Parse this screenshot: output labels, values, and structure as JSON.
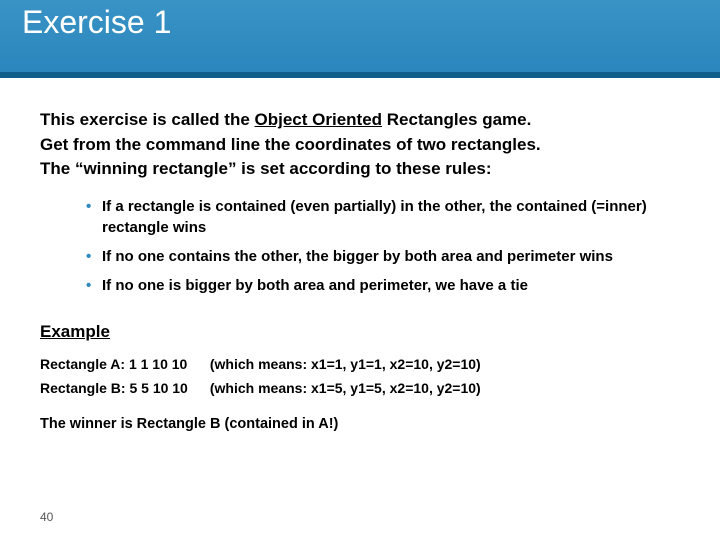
{
  "title": "Exercise 1",
  "intro": {
    "line1_pre": "This exercise is called the ",
    "line1_u": "Object Oriented",
    "line1_post": " Rectangles game.",
    "line2": "Get from the command line the coordinates of two rectangles.",
    "line3": "The “winning rectangle” is set according to these rules:"
  },
  "bullets": [
    "If a rectangle is contained (even partially) in the other, the contained (=inner) rectangle wins",
    "If no one contains the other, the bigger by both area and perimeter wins",
    "If no one is bigger by both area and perimeter, we have a tie"
  ],
  "example": {
    "heading": "Example",
    "rows": [
      {
        "label": "Rectangle A: 1 1 10 10",
        "meaning": "(which means: x1=1, y1=1, x2=10, y2=10)"
      },
      {
        "label": "Rectangle B: 5 5 10 10",
        "meaning": "(which means: x1=5, y1=5, x2=10, y2=10)"
      }
    ],
    "winner": "The winner is Rectangle B  (contained in A!)"
  },
  "page_number": "40"
}
